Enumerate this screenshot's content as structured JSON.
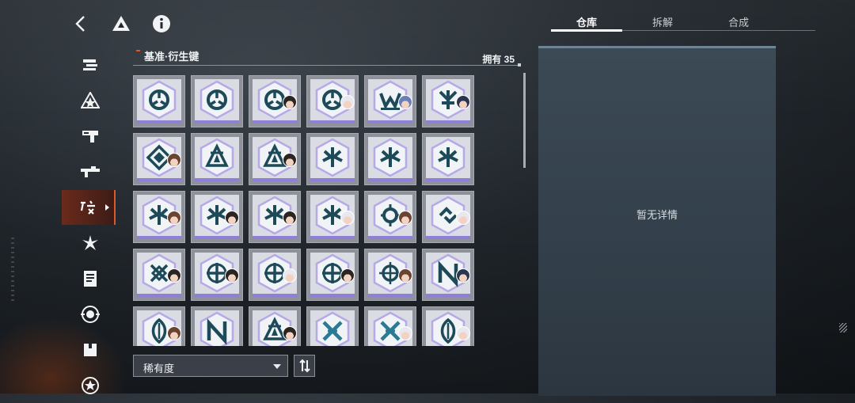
{
  "header": {
    "title": "基准·衍生键",
    "owned_count": "拥有 35"
  },
  "tabs": [
    {
      "label": "仓库",
      "active": true
    },
    {
      "label": "拆解",
      "active": false
    },
    {
      "label": "合成",
      "active": false
    }
  ],
  "detail": {
    "empty_text": "暂无详情"
  },
  "sort": {
    "selected": "稀有度",
    "toggle_icon": "sort-order-icon"
  },
  "sidebar": {
    "active_index": 4,
    "active_tag": "",
    "icons": [
      "stack-icon",
      "triangle-star-icon",
      "gun-icon",
      "rifle-icon",
      "derivative-key-icon",
      "flower-icon",
      "document-icon",
      "target-icon",
      "box-icon",
      "star-circle-icon"
    ]
  },
  "topbar": {
    "icons": [
      "back-arrow-icon",
      "home-triangle-icon",
      "info-icon"
    ]
  },
  "items": [
    {
      "emblem": "tri-loop",
      "avatar": null
    },
    {
      "emblem": "tri-loop",
      "avatar": null
    },
    {
      "emblem": "tri-loop",
      "avatar": "dark"
    },
    {
      "emblem": "tri-loop",
      "avatar": "white"
    },
    {
      "emblem": "m-wing",
      "avatar": "blue"
    },
    {
      "emblem": "trident",
      "avatar": "navy"
    },
    {
      "emblem": "diamond",
      "avatar": "brown"
    },
    {
      "emblem": "tri-star",
      "avatar": null
    },
    {
      "emblem": "tri-star",
      "avatar": "dark"
    },
    {
      "emblem": "tri-fork",
      "avatar": null
    },
    {
      "emblem": "tri-fork",
      "avatar": null
    },
    {
      "emblem": "tri-fork",
      "avatar": null
    },
    {
      "emblem": "tri-fork",
      "avatar": "brown"
    },
    {
      "emblem": "tri-fork",
      "avatar": "dark"
    },
    {
      "emblem": "tri-fork",
      "avatar": "dark"
    },
    {
      "emblem": "tri-fork",
      "avatar": "white"
    },
    {
      "emblem": "orb",
      "avatar": "brown"
    },
    {
      "emblem": "link",
      "avatar": "white"
    },
    {
      "emblem": "cross-knot",
      "avatar": "dark"
    },
    {
      "emblem": "compass",
      "avatar": "dark"
    },
    {
      "emblem": "compass",
      "avatar": "white"
    },
    {
      "emblem": "compass",
      "avatar": "dark"
    },
    {
      "emblem": "gear-cross",
      "avatar": "brown"
    },
    {
      "emblem": "n-mark",
      "avatar": "navy"
    },
    {
      "emblem": "leaf",
      "avatar": "brown"
    },
    {
      "emblem": "n-mark",
      "avatar": null
    },
    {
      "emblem": "tri-star",
      "avatar": "dark"
    },
    {
      "emblem": "x-mark",
      "avatar": null
    },
    {
      "emblem": "x-mark",
      "avatar": "white"
    },
    {
      "emblem": "leaf",
      "avatar": "white"
    }
  ],
  "colors": {
    "accent": "#e05a28",
    "rarity_purple": "#8f7fd6",
    "emblem_teal": "#1d4a58"
  }
}
